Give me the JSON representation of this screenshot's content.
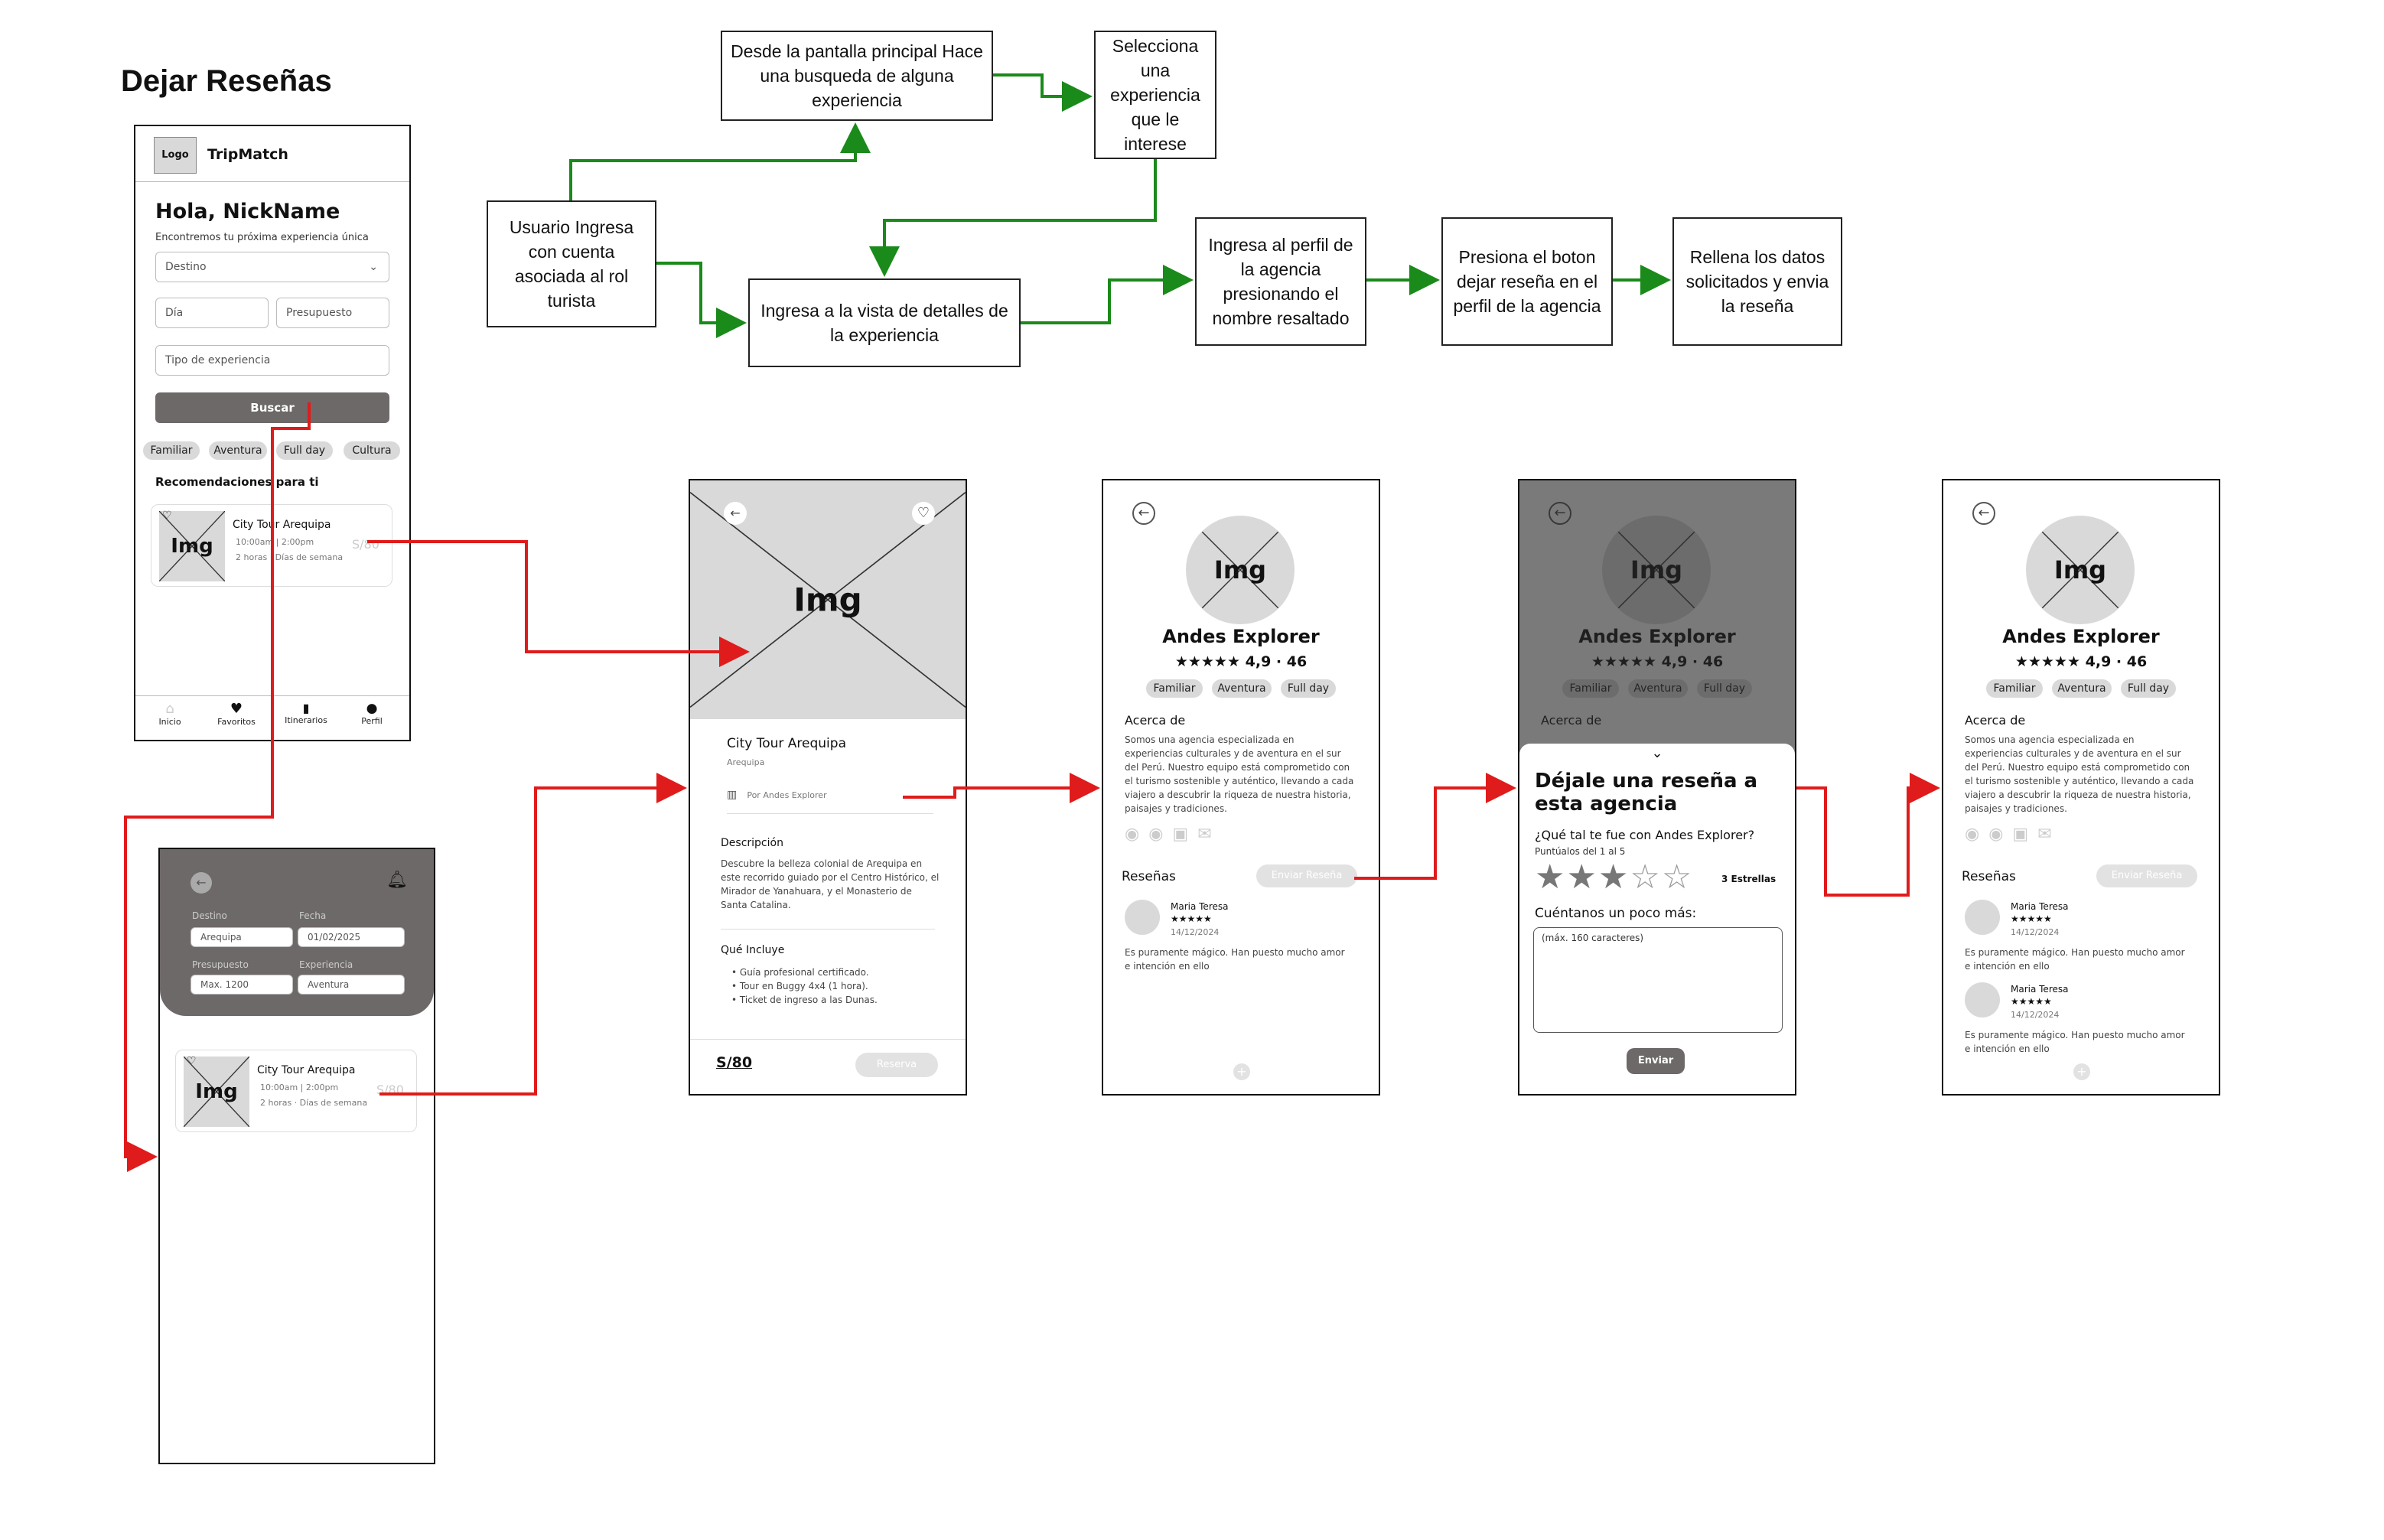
{
  "page_title": "Dejar Reseñas",
  "flow": {
    "box1": "Usuario Ingresa con cuenta asociada al rol turista",
    "box2": "Desde la pantalla principal Hace una busqueda de alguna experiencia",
    "box3": "Selecciona una experiencia que le interese",
    "box4": "Ingresa a la vista de detalles de la experiencia",
    "box5": "Ingresa al perfil de la agencia presionando el nombre resaltado",
    "box6": "Presiona el boton dejar reseña en el perfil de la agencia",
    "box7": "Rellena los datos solicitados  y envia la reseña"
  },
  "colors": {
    "flow_arrow": "#1a8a1a",
    "nav_arrow": "#e01b1b",
    "placeholder": "#d9d9d9",
    "dark_header": "#6d6968"
  },
  "home": {
    "logo": "Logo",
    "app_name": "TripMatch",
    "greeting": "Hola, NickName",
    "subtitle": "Encontremos tu próxima experiencia única",
    "destino": "Destino",
    "dia": "Día",
    "presupuesto": "Presupuesto",
    "tipo": "Tipo de experiencia",
    "buscar": "Buscar",
    "chips": [
      "Familiar",
      "Aventura",
      "Full day",
      "Cultura"
    ],
    "rec_title": "Recomendaciones para ti",
    "card": {
      "img": "Img",
      "title": "City Tour Arequipa",
      "time": "10:00am | 2:00pm",
      "dur": "2 horas · Días de semana",
      "price": "S/80"
    },
    "nav": [
      "Inicio",
      "Favoritos",
      "Itinerarios",
      "Perfil"
    ]
  },
  "search": {
    "labels": [
      "Destino",
      "Fecha",
      "Presupuesto",
      "Experiencia"
    ],
    "values": [
      "Arequipa",
      "01/02/2025",
      "Max. 1200",
      "Aventura"
    ],
    "card": {
      "img": "Img",
      "title": "City Tour Arequipa",
      "time": "10:00am | 2:00pm",
      "dur": "2 horas · Días de semana",
      "price": "S/80"
    }
  },
  "detail": {
    "img": "Img",
    "title": "City Tour Arequipa",
    "location": "Arequipa",
    "agency": "Por Andes Explorer",
    "desc_title": "Descripción",
    "desc": "Descubre la belleza colonial de Arequipa en este recorrido guiado por el Centro Histórico, el Mirador de Yanahuara, y el Monasterio de Santa Catalina.",
    "includes_title": "Qué Incluye",
    "includes": [
      "Guía profesional certificado.",
      "Tour en Buggy 4x4 (1 hora).",
      "Ticket de ingreso a las Dunas."
    ],
    "price": "S/80",
    "reserve": "Reserva"
  },
  "agency": {
    "img": "Img",
    "name": "Andes Explorer",
    "stars": "★★★★★",
    "rating": "4,9 · 46",
    "chips": [
      "Familiar",
      "Aventura",
      "Full day"
    ],
    "about_title": "Acerca de",
    "about": "Somos una agencia especializada en experiencias culturales y de aventura en el sur del Perú. Nuestro equipo está comprometido con el turismo sostenible y auténtico, llevando a cada viajero a descubrir la riqueza de nuestra historia, paisajes y tradiciones.",
    "reviews_title": "Reseñas",
    "review_btn": "Enviar Reseña",
    "review": {
      "name": "Maria Teresa",
      "stars": "★★★★★",
      "date": "14/12/2024",
      "text": "Es puramente mágico. Han puesto mucho amor e intención en ello"
    }
  },
  "modal": {
    "title": "Déjale una reseña a esta agencia",
    "question": "¿Qué tal te fue con Andes Explorer?",
    "hint": "Puntúalos del 1 al 5",
    "stars_label": "3 Estrellas",
    "rating": 3,
    "more": "Cuéntanos un poco más:",
    "placeholder": "(máx. 160 caracteres)",
    "send": "Enviar"
  }
}
